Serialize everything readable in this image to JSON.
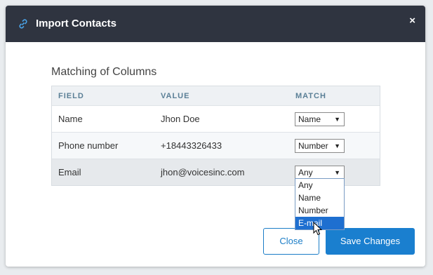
{
  "modal": {
    "title": "Import Contacts",
    "close_glyph": "×",
    "title_icon": "link-icon"
  },
  "section_title": "Matching of Columns",
  "table": {
    "headers": [
      "FIELD",
      "VALUE",
      "MATCH"
    ],
    "rows": [
      {
        "field": "Name",
        "value": "Jhon Doe",
        "match": "Name"
      },
      {
        "field": "Phone number",
        "value": "+18443326433",
        "match": "Number"
      },
      {
        "field": "Email",
        "value": "jhon@voicesinc.com",
        "match": "Any"
      }
    ]
  },
  "dropdown": {
    "options": [
      "Any",
      "Name",
      "Number",
      "E-mail"
    ],
    "highlighted": "E-mail"
  },
  "buttons": {
    "close": "Close",
    "save": "Save Changes"
  },
  "colors": {
    "header_bg": "#2f3440",
    "primary": "#1a7fcf",
    "column_header_text": "#5a7f96"
  }
}
